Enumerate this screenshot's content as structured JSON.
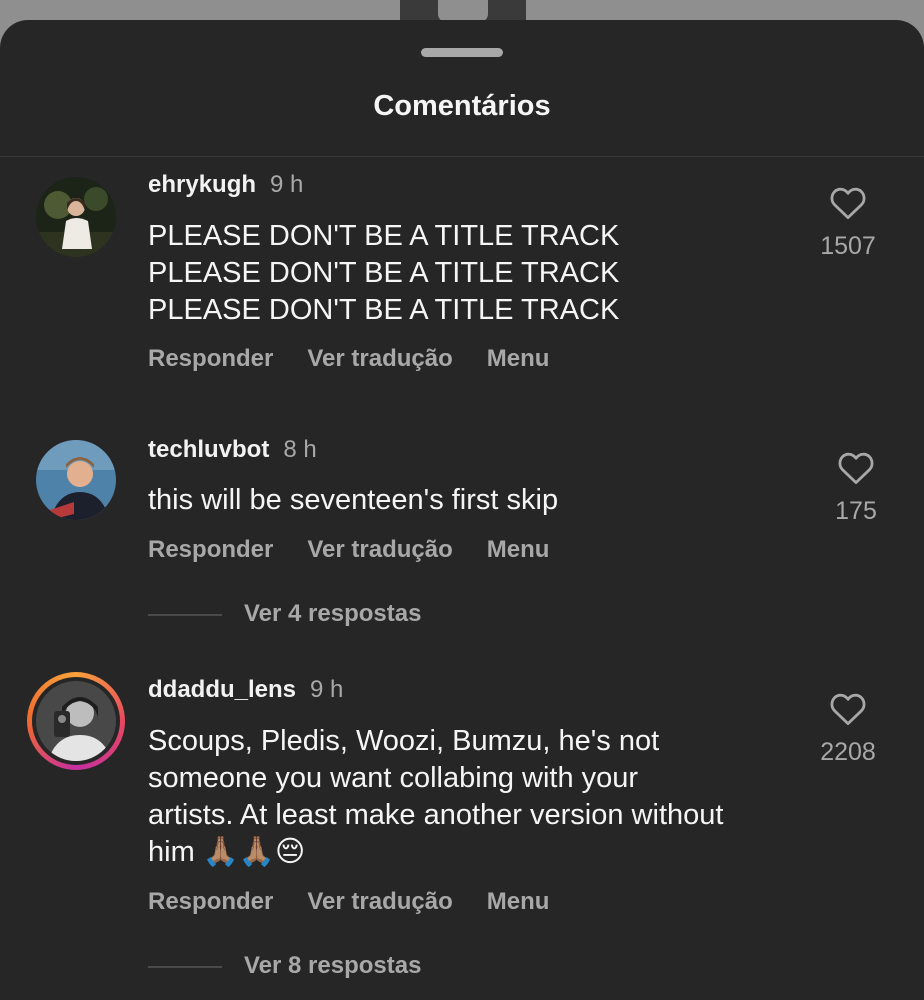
{
  "sheet": {
    "title": "Comentários"
  },
  "comments": [
    {
      "username": "ehrykugh",
      "time": "9 h",
      "text": "PLEASE DON'T BE A TITLE TRACK\nPLEASE DON'T BE A TITLE TRACK\nPLEASE DON'T BE A TITLE TRACK",
      "likes": "1507",
      "actions": {
        "reply": "Responder",
        "translate": "Ver tradução",
        "menu": "Menu"
      },
      "avatar_icon": "user-avatar-photo"
    },
    {
      "username": "techluvbot",
      "time": "8 h",
      "text": "this will be seventeen's first skip",
      "likes": "175",
      "actions": {
        "reply": "Responder",
        "translate": "Ver tradução",
        "menu": "Menu"
      },
      "view_replies": "Ver 4 respostas",
      "avatar_icon": "user-avatar-photo"
    },
    {
      "username": "ddaddu_lens",
      "time": "9 h",
      "text": "Scoups, Pledis, Woozi, Bumzu, he's not\nsomeone you want collabing with your\nartists. At least make another version without\nhim 🙏🏽🙏🏽😔",
      "likes": "2208",
      "actions": {
        "reply": "Responder",
        "translate": "Ver tradução",
        "menu": "Menu"
      },
      "view_replies": "Ver 8 respostas",
      "avatar_icon": "user-avatar-photo-story-ring"
    }
  ],
  "colors": {
    "sheet_bg": "#262626",
    "primary_text": "#f5f5f5",
    "secondary_text": "#a8a8a8"
  }
}
